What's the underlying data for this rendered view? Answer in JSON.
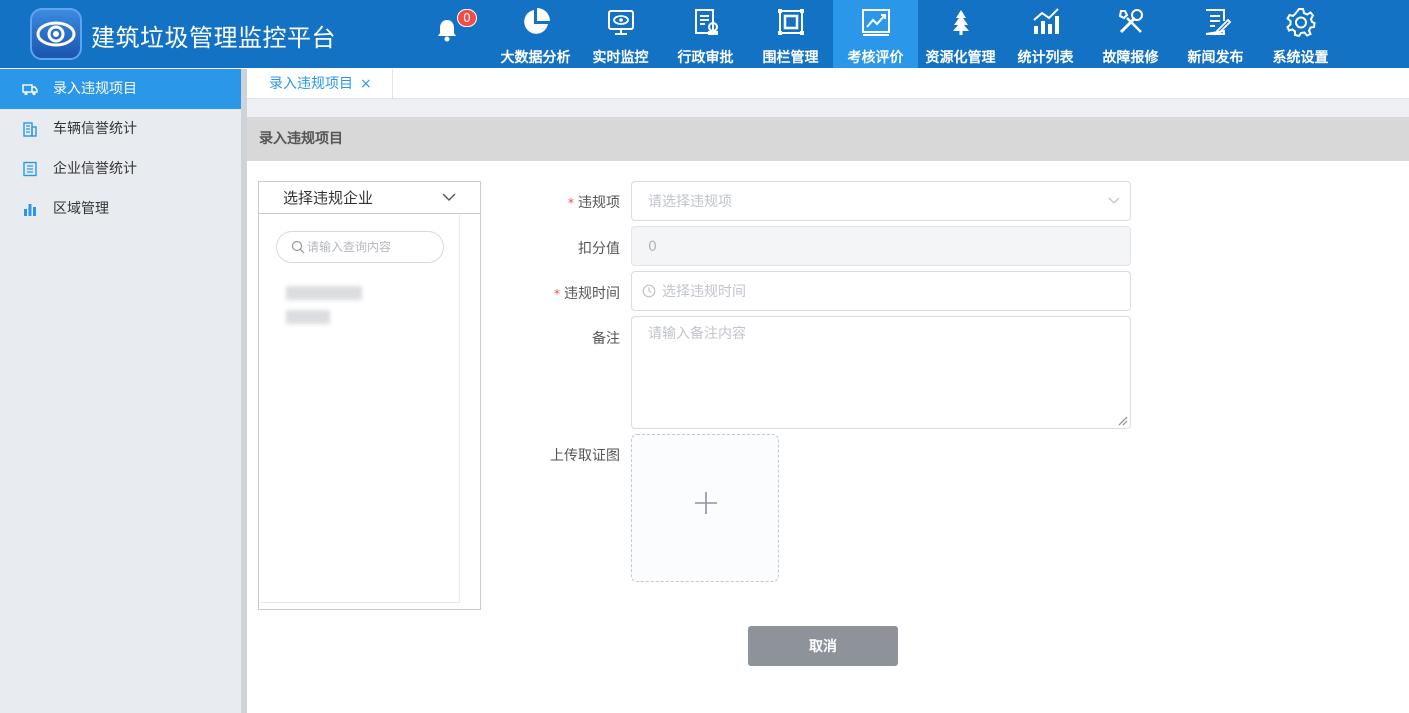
{
  "header": {
    "title": "建筑垃圾管理监控平台",
    "notification_count": "0"
  },
  "nav": {
    "items": [
      {
        "label": "大数据分析",
        "icon": "pie-chart-icon"
      },
      {
        "label": "实时监控",
        "icon": "monitor-eye-icon"
      },
      {
        "label": "行政审批",
        "icon": "approval-doc-icon"
      },
      {
        "label": "围栏管理",
        "icon": "fence-square-icon"
      },
      {
        "label": "考核评价",
        "icon": "trend-chart-icon"
      },
      {
        "label": "资源化管理",
        "icon": "recycle-tree-icon"
      },
      {
        "label": "统计列表",
        "icon": "bar-trend-icon"
      },
      {
        "label": "故障报修",
        "icon": "tools-icon"
      },
      {
        "label": "新闻发布",
        "icon": "news-edit-icon"
      },
      {
        "label": "系统设置",
        "icon": "gear-icon"
      }
    ],
    "active_index": 4
  },
  "sidebar": {
    "items": [
      {
        "label": "录入违规项目",
        "icon": "truck-icon"
      },
      {
        "label": "车辆信誉统计",
        "icon": "building-icon"
      },
      {
        "label": "企业信誉统计",
        "icon": "document-list-icon"
      },
      {
        "label": "区域管理",
        "icon": "bar-chart-icon"
      }
    ],
    "active_index": 0
  },
  "tabs": [
    {
      "label": "录入违规项目",
      "close": "×"
    }
  ],
  "section": {
    "title": "录入违规项目"
  },
  "enterprise_panel": {
    "select_label": "选择违规企业",
    "search_placeholder": "请输入查询内容"
  },
  "form": {
    "violation_item": {
      "label": "违规项",
      "required": "*",
      "placeholder": "请选择违规项"
    },
    "deduction": {
      "label": "扣分值",
      "value": "0"
    },
    "violation_time": {
      "label": "违规时间",
      "required": "*",
      "placeholder": "选择违规时间"
    },
    "remark": {
      "label": "备注",
      "placeholder": "请输入备注内容"
    },
    "upload": {
      "label": "上传取证图"
    }
  },
  "actions": {
    "cancel_label": "取消"
  },
  "colors": {
    "header_bg": "#1472c4",
    "accent": "#2b97e8",
    "required": "#f24b4b",
    "cancel_bg": "#8e9299"
  }
}
